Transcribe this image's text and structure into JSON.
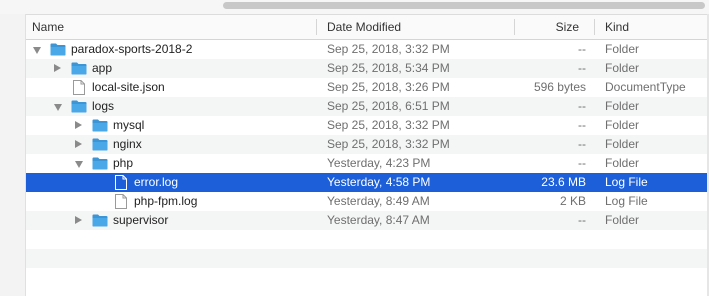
{
  "columns": {
    "name": "Name",
    "date_modified": "Date Modified",
    "size": "Size",
    "kind": "Kind"
  },
  "rows": [
    {
      "name": "paradox-sports-2018-2",
      "date": "Sep 25, 2018, 3:32 PM",
      "size": "--",
      "kind": "Folder",
      "type": "folder",
      "disclosure": "open",
      "depth": 0
    },
    {
      "name": "app",
      "date": "Sep 25, 2018, 5:34 PM",
      "size": "--",
      "kind": "Folder",
      "type": "folder",
      "disclosure": "closed",
      "depth": 1
    },
    {
      "name": "local-site.json",
      "date": "Sep 25, 2018, 3:26 PM",
      "size": "596 bytes",
      "kind": "DocumentType",
      "type": "file",
      "disclosure": "none",
      "depth": 1
    },
    {
      "name": "logs",
      "date": "Sep 25, 2018, 6:51 PM",
      "size": "--",
      "kind": "Folder",
      "type": "folder",
      "disclosure": "open",
      "depth": 1
    },
    {
      "name": "mysql",
      "date": "Sep 25, 2018, 3:32 PM",
      "size": "--",
      "kind": "Folder",
      "type": "folder",
      "disclosure": "closed",
      "depth": 2
    },
    {
      "name": "nginx",
      "date": "Sep 25, 2018, 3:32 PM",
      "size": "--",
      "kind": "Folder",
      "type": "folder",
      "disclosure": "closed",
      "depth": 2
    },
    {
      "name": "php",
      "date": "Yesterday, 4:23 PM",
      "size": "--",
      "kind": "Folder",
      "type": "folder",
      "disclosure": "open",
      "depth": 2
    },
    {
      "name": "error.log",
      "date": "Yesterday, 4:58 PM",
      "size": "23.6 MB",
      "kind": "Log File",
      "type": "file",
      "disclosure": "none",
      "depth": 3,
      "selected": true
    },
    {
      "name": "php-fpm.log",
      "date": "Yesterday, 8:49 AM",
      "size": "2 KB",
      "kind": "Log File",
      "type": "file",
      "disclosure": "none",
      "depth": 3
    },
    {
      "name": "supervisor",
      "date": "Yesterday, 8:47 AM",
      "size": "--",
      "kind": "Folder",
      "type": "folder",
      "disclosure": "closed",
      "depth": 2
    }
  ],
  "colors": {
    "selection": "#1c5fd9",
    "folder": "#4aa8e8",
    "folder_tab": "#3d95d6",
    "secondary_text": "#6f6f6f"
  },
  "icons": {
    "folder": "folder-icon",
    "file": "document-icon",
    "disclosure_open": "disclosure-triangle-open-icon",
    "disclosure_closed": "disclosure-triangle-closed-icon"
  }
}
